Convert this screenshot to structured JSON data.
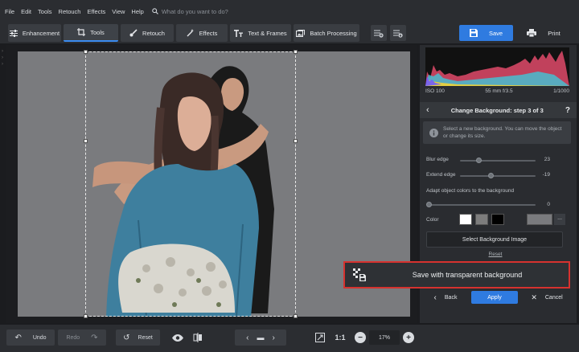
{
  "menu": [
    "File",
    "Edit",
    "Tools",
    "Retouch",
    "Effects",
    "View",
    "Help"
  ],
  "search": {
    "placeholder": "What do you want to do?"
  },
  "tabs": [
    {
      "label": "Enhancement",
      "icon": "sliders-icon"
    },
    {
      "label": "Tools",
      "icon": "crop-icon"
    },
    {
      "label": "Retouch",
      "icon": "brush-icon"
    },
    {
      "label": "Effects",
      "icon": "magic-wand-icon"
    },
    {
      "label": "Text & Frames",
      "icon": "text-icon"
    },
    {
      "label": "Batch Processing",
      "icon": "batch-image-icon"
    }
  ],
  "toolbar": {
    "save_label": "Save",
    "print_label": "Print"
  },
  "histogram_info": {
    "iso": "ISO 100",
    "lens": "55 mm f/3.5",
    "shutter": "1/1000"
  },
  "step": {
    "title": "Change Background: step 3 of 3",
    "help": "?"
  },
  "info": {
    "text": "Select a new background. You can move the object or change its size."
  },
  "sliders": {
    "blur_label": "Blur edge",
    "blur_value": "23",
    "extend_label": "Extend edge",
    "extend_value": "-19",
    "adapt_label": "Adapt object colors to the background",
    "adapt_value": "0"
  },
  "color": {
    "label": "Color",
    "swatches": [
      "#ffffff",
      "#7d7d7d",
      "#000000"
    ],
    "selected": "#7a7b7e",
    "more": "..."
  },
  "bg_button": "Select Background Image",
  "reset_link": "Reset",
  "popup": {
    "label": "Save with transparent background"
  },
  "nav": {
    "back": "Back",
    "apply": "Apply",
    "cancel": "Cancel"
  },
  "bottom": {
    "undo": "Undo",
    "redo": "Redo",
    "reset": "Reset",
    "ratio": "1:1",
    "zoom": "17%"
  },
  "colors": {
    "accent": "#2f7be0",
    "highlight": "#d6322f"
  }
}
